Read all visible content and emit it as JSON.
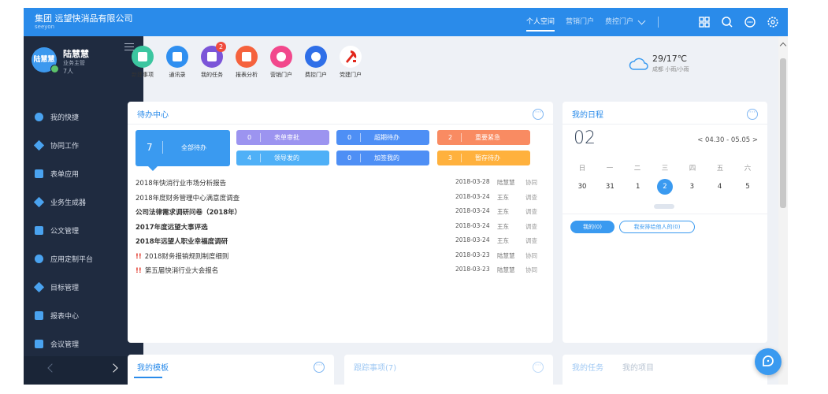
{
  "app": {
    "brand_name": "集团  远望快消品有限公司",
    "brand_sub": "seeyon"
  },
  "topnav": {
    "items": [
      {
        "label": "个人空间",
        "active": true
      },
      {
        "label": "营销门户",
        "active": false
      },
      {
        "label": "费控门户",
        "active": false
      }
    ],
    "icons": [
      "grid-icon",
      "search-icon",
      "message-icon",
      "settings-icon"
    ]
  },
  "user": {
    "avatar_text": "陆慧慧",
    "name": "陆慧慧",
    "role": "业务主管",
    "count": "7人"
  },
  "sidebar": {
    "items": [
      {
        "label": "我的快捷",
        "icon": "shortcut-icon"
      },
      {
        "label": "协同工作",
        "icon": "collaboration-icon"
      },
      {
        "label": "表单应用",
        "icon": "form-icon"
      },
      {
        "label": "业务生成器",
        "icon": "generator-icon"
      },
      {
        "label": "公文管理",
        "icon": "document-icon"
      },
      {
        "label": "应用定制平台",
        "icon": "platform-icon"
      },
      {
        "label": "目标管理",
        "icon": "target-icon"
      },
      {
        "label": "报表中心",
        "icon": "report-icon"
      },
      {
        "label": "会议管理",
        "icon": "meeting-icon"
      }
    ]
  },
  "quick": {
    "items": [
      {
        "label": "新建事项",
        "color": "#3cc6a0"
      },
      {
        "label": "通讯录",
        "color": "#2f8ff0"
      },
      {
        "label": "我的任务",
        "color": "#7b55d8",
        "badge": "2"
      },
      {
        "label": "报表分析",
        "color": "#f5623d"
      },
      {
        "label": "营销门户",
        "color": "#f2488c"
      },
      {
        "label": "费控门户",
        "color": "#2f6fe8"
      },
      {
        "label": "党建门户",
        "color": "#ffffff"
      }
    ]
  },
  "weather": {
    "temp": "29/17℃",
    "location": "成都 小雨/小雨"
  },
  "todo": {
    "title": "待办中心",
    "all_count": "7",
    "all_label": "全部待办",
    "chips": [
      {
        "count": "0",
        "label": "表单审批",
        "color": "#9c94f0"
      },
      {
        "count": "0",
        "label": "超期待办",
        "color": "#4e8ff5"
      },
      {
        "count": "2",
        "label": "重要紧急",
        "color": "#f98b62"
      },
      {
        "count": "4",
        "label": "领导发的",
        "color": "#4fb0f7"
      },
      {
        "count": "0",
        "label": "加签我的",
        "color": "#4e8ff5"
      },
      {
        "count": "3",
        "label": "暂存待办",
        "color": "#ffb13d"
      }
    ],
    "rows": [
      {
        "title": "2018年快消行业市场分析报告",
        "date": "2018-03-28",
        "user": "陆慧慧",
        "type": "协同",
        "bold": false,
        "urgent": false
      },
      {
        "title": "2018年度财务管理中心满意度调查",
        "date": "2018-03-24",
        "user": "王东",
        "type": "调查",
        "bold": false,
        "urgent": false
      },
      {
        "title": "公司法律需求调研问卷（2018年）",
        "date": "2018-03-24",
        "user": "王东",
        "type": "调查",
        "bold": true,
        "urgent": false
      },
      {
        "title": "2017年度远望大事评选",
        "date": "2018-03-24",
        "user": "王东",
        "type": "调查",
        "bold": true,
        "urgent": false
      },
      {
        "title": "2018年远望人职业幸福度调研",
        "date": "2018-03-24",
        "user": "王东",
        "type": "调查",
        "bold": true,
        "urgent": false
      },
      {
        "title": "2018财务报销规则制度细则",
        "date": "2018-03-23",
        "user": "陆慧慧",
        "type": "协同",
        "bold": false,
        "urgent": true
      },
      {
        "title": "第五届快消行业大会报名",
        "date": "2018-03-23",
        "user": "陆慧慧",
        "type": "协同",
        "bold": false,
        "urgent": true
      }
    ]
  },
  "schedule": {
    "title": "我的日程",
    "day": "02",
    "range": "< 04.30 - 05.05 >",
    "weekdays": [
      "日",
      "一",
      "二",
      "三",
      "四",
      "五",
      "六"
    ],
    "dates": [
      "30",
      "31",
      "1",
      "2",
      "3",
      "4",
      "5"
    ],
    "today_index": 3,
    "btn_mine": "我的(0)",
    "btn_others": "我安排给他人的(0)"
  },
  "bottom": {
    "template_title": "我的模板",
    "tracking_title": "跟踪事项(7)",
    "tasks_title": "我的任务",
    "projects_title": "我的项目"
  }
}
